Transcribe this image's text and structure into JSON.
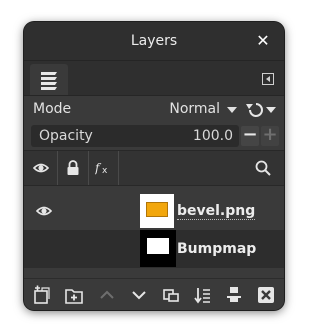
{
  "window": {
    "title": "Layers",
    "close_icon": "close-icon"
  },
  "tabs": {
    "active_icon": "layers-stack-icon",
    "menu_icon": "tab-menu-icon"
  },
  "mode": {
    "label": "Mode",
    "value": "Normal"
  },
  "opacity": {
    "label": "Opacity",
    "value": "100.0",
    "minus": "−",
    "plus": "+"
  },
  "list_header": {
    "visibility_icon": "eye-icon",
    "lock_icon": "lock-icon",
    "effects_icon": "fx-icon",
    "search_icon": "search-icon"
  },
  "layers": [
    {
      "name": "bevel.png",
      "visible": true,
      "thumbnail": "orange-rectangle",
      "editing": true
    },
    {
      "name": "Bumpmap",
      "visible": false,
      "thumbnail": "white-rectangle-on-black",
      "editing": false
    }
  ],
  "toolbar_icons": [
    "new-layer-icon",
    "new-layer-group-icon",
    "raise-layer-icon",
    "lower-layer-icon",
    "duplicate-layer-icon",
    "merge-down-icon",
    "anchor-layer-icon",
    "delete-layer-icon"
  ],
  "colors": {
    "dialog_bg": "#3a3a3a",
    "titlebar_bg": "#2f2f2f",
    "thumb_orange": "#f2a70d"
  }
}
